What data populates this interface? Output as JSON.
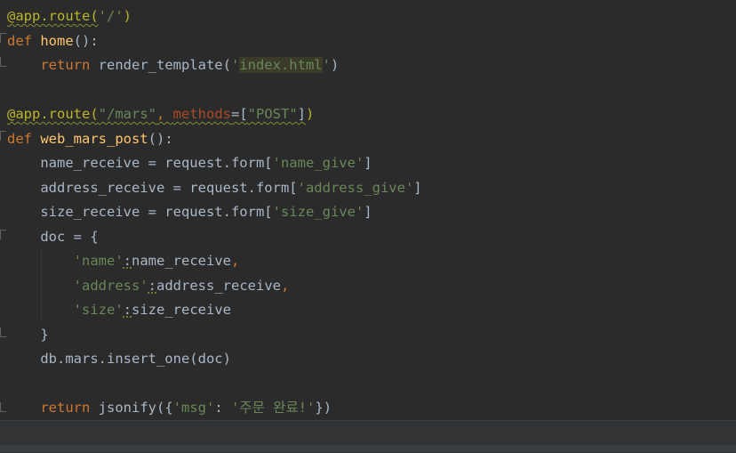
{
  "editor": {
    "lines": [
      {
        "t": "@app.route('/')"
      },
      {
        "t": "def home():"
      },
      {
        "t": "    return render_template('index.html')"
      },
      {
        "t": ""
      },
      {
        "t": "@app.route(\"/mars\", methods=[\"POST\"])"
      },
      {
        "t": "def web_mars_post():"
      },
      {
        "t": "    name_receive = request.form['name_give']"
      },
      {
        "t": "    address_receive = request.form['address_give']"
      },
      {
        "t": "    size_receive = request.form['size_give']"
      },
      {
        "t": "    doc = {"
      },
      {
        "t": "        'name':name_receive,"
      },
      {
        "t": "        'address':address_receive,"
      },
      {
        "t": "        'size':size_receive"
      },
      {
        "t": "    }"
      },
      {
        "t": "    db.mars.insert_one(doc)"
      },
      {
        "t": ""
      },
      {
        "t": "    return jsonify({'msg': '주문 완료!'})"
      }
    ],
    "colors": {
      "background": "#2b2b2b",
      "keyword": "#cc7832",
      "decorator": "#bbb529",
      "function": "#ffc66d",
      "string": "#6a8759",
      "default": "#a9b7c6"
    }
  }
}
